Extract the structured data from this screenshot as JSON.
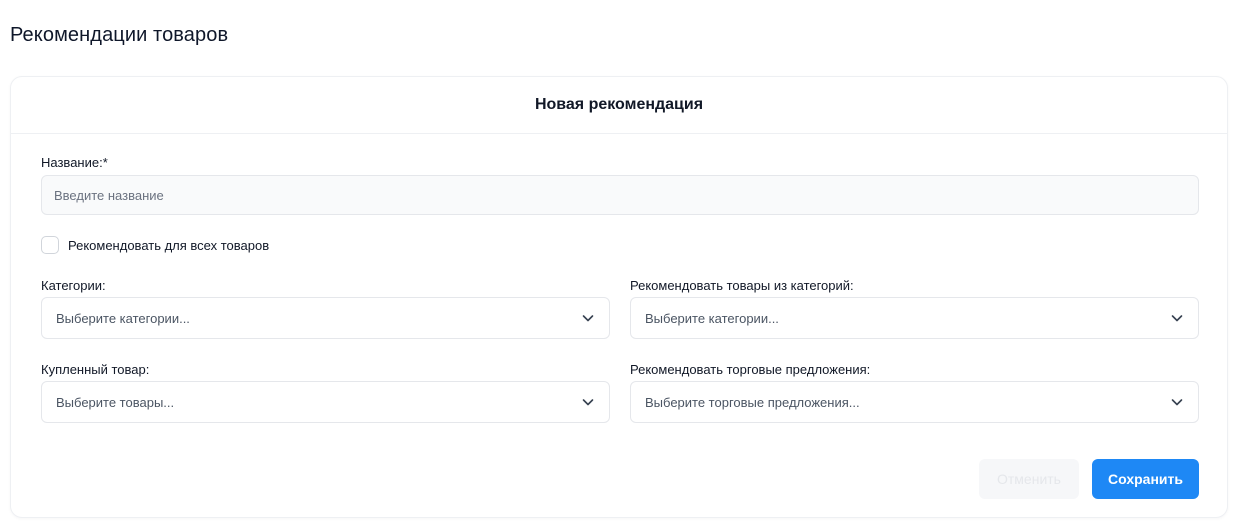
{
  "page": {
    "title": "Рекомендации товаров"
  },
  "card": {
    "title": "Новая рекомендация"
  },
  "form": {
    "name": {
      "label": "Название:*",
      "placeholder": "Введите название",
      "value": ""
    },
    "recommend_all": {
      "label": "Рекомендовать для всех товаров",
      "checked": false
    },
    "categories": {
      "label": "Категории:",
      "placeholder": "Выберите категории..."
    },
    "recommend_categories": {
      "label": "Рекомендовать товары из категорий:",
      "placeholder": "Выберите категории..."
    },
    "purchased_product": {
      "label": "Купленный товар:",
      "placeholder": "Выберите товары..."
    },
    "recommend_offers": {
      "label": "Рекомендовать торговые предложения:",
      "placeholder": "Выберите торговые предложения..."
    }
  },
  "actions": {
    "cancel_label": "Отменить",
    "save_label": "Сохранить"
  },
  "colors": {
    "accent": "#1e88f5",
    "input_bg": "#f9fafb",
    "border": "#e5e7eb"
  },
  "icons": {
    "select_arrow": "chevron-down-icon"
  }
}
